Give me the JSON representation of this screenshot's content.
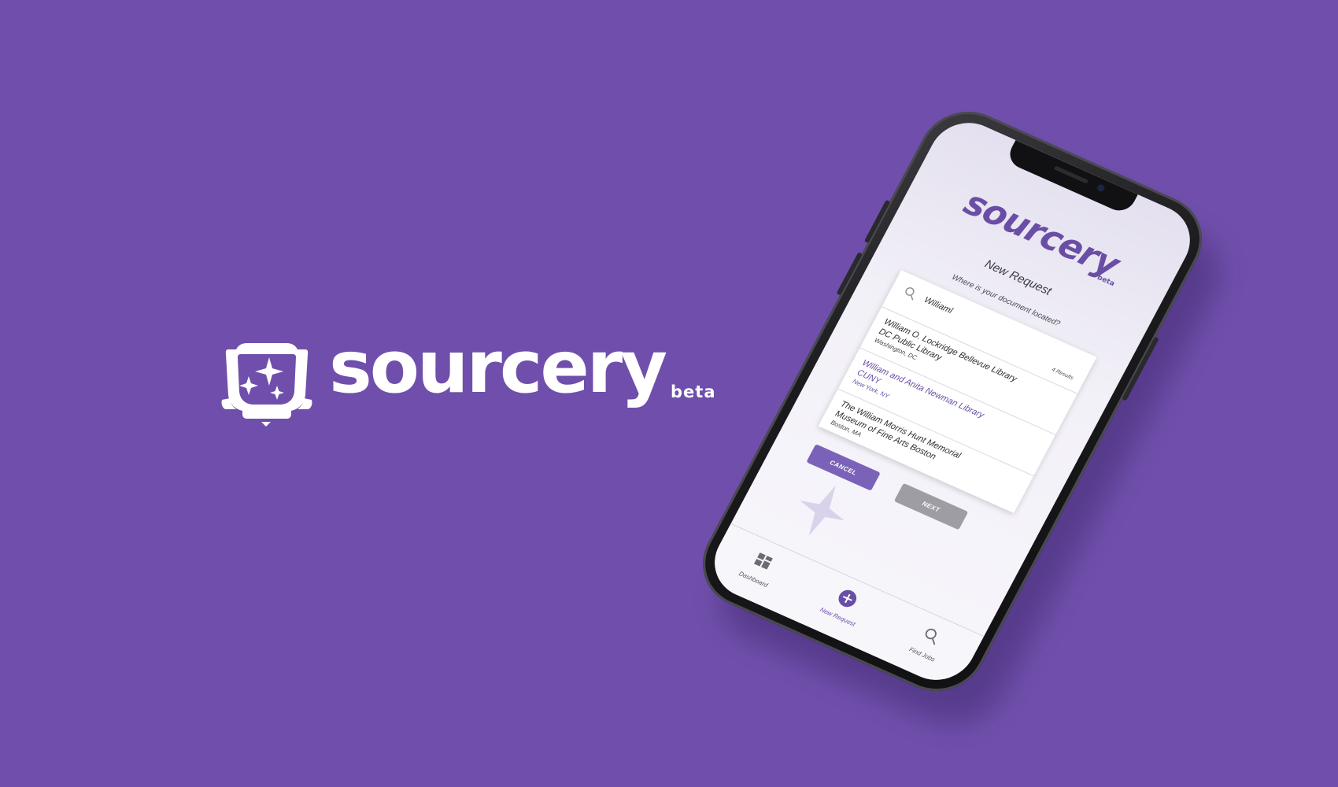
{
  "hero": {
    "wordmark": "sourcery",
    "tag": "beta"
  },
  "app": {
    "logo": "sourcery",
    "logo_tag": "beta",
    "page_title": "New Request",
    "prompt": "Where is your document located?",
    "search": {
      "value": "Williaml",
      "results_count": "4 Results"
    },
    "results": [
      {
        "name": "William O. Lockridge Bellevue Library",
        "sub": "DC Public Library",
        "location": "Washington, DC"
      },
      {
        "name": "William and Anita Newman Library",
        "sub": "CUNY",
        "location": "New York, NY"
      },
      {
        "name": "The William Morris Hunt Memorial",
        "sub": "Museum of Fine Arts Boston",
        "location": "Boston, MA"
      }
    ],
    "selected_result_index": 1,
    "buttons": {
      "cancel": "CANCEL",
      "next": "NEXT"
    },
    "tabs": [
      {
        "label": "Dashboard",
        "icon": "dashboard-icon"
      },
      {
        "label": "New Request",
        "icon": "plus-circle-icon"
      },
      {
        "label": "Find Jobs",
        "icon": "search-icon"
      }
    ],
    "active_tab_index": 1
  },
  "colors": {
    "background": "#6f4fab",
    "brand": "#6a4ea6",
    "cancel_button": "#7a62b8",
    "next_button": "#9d9da3"
  }
}
